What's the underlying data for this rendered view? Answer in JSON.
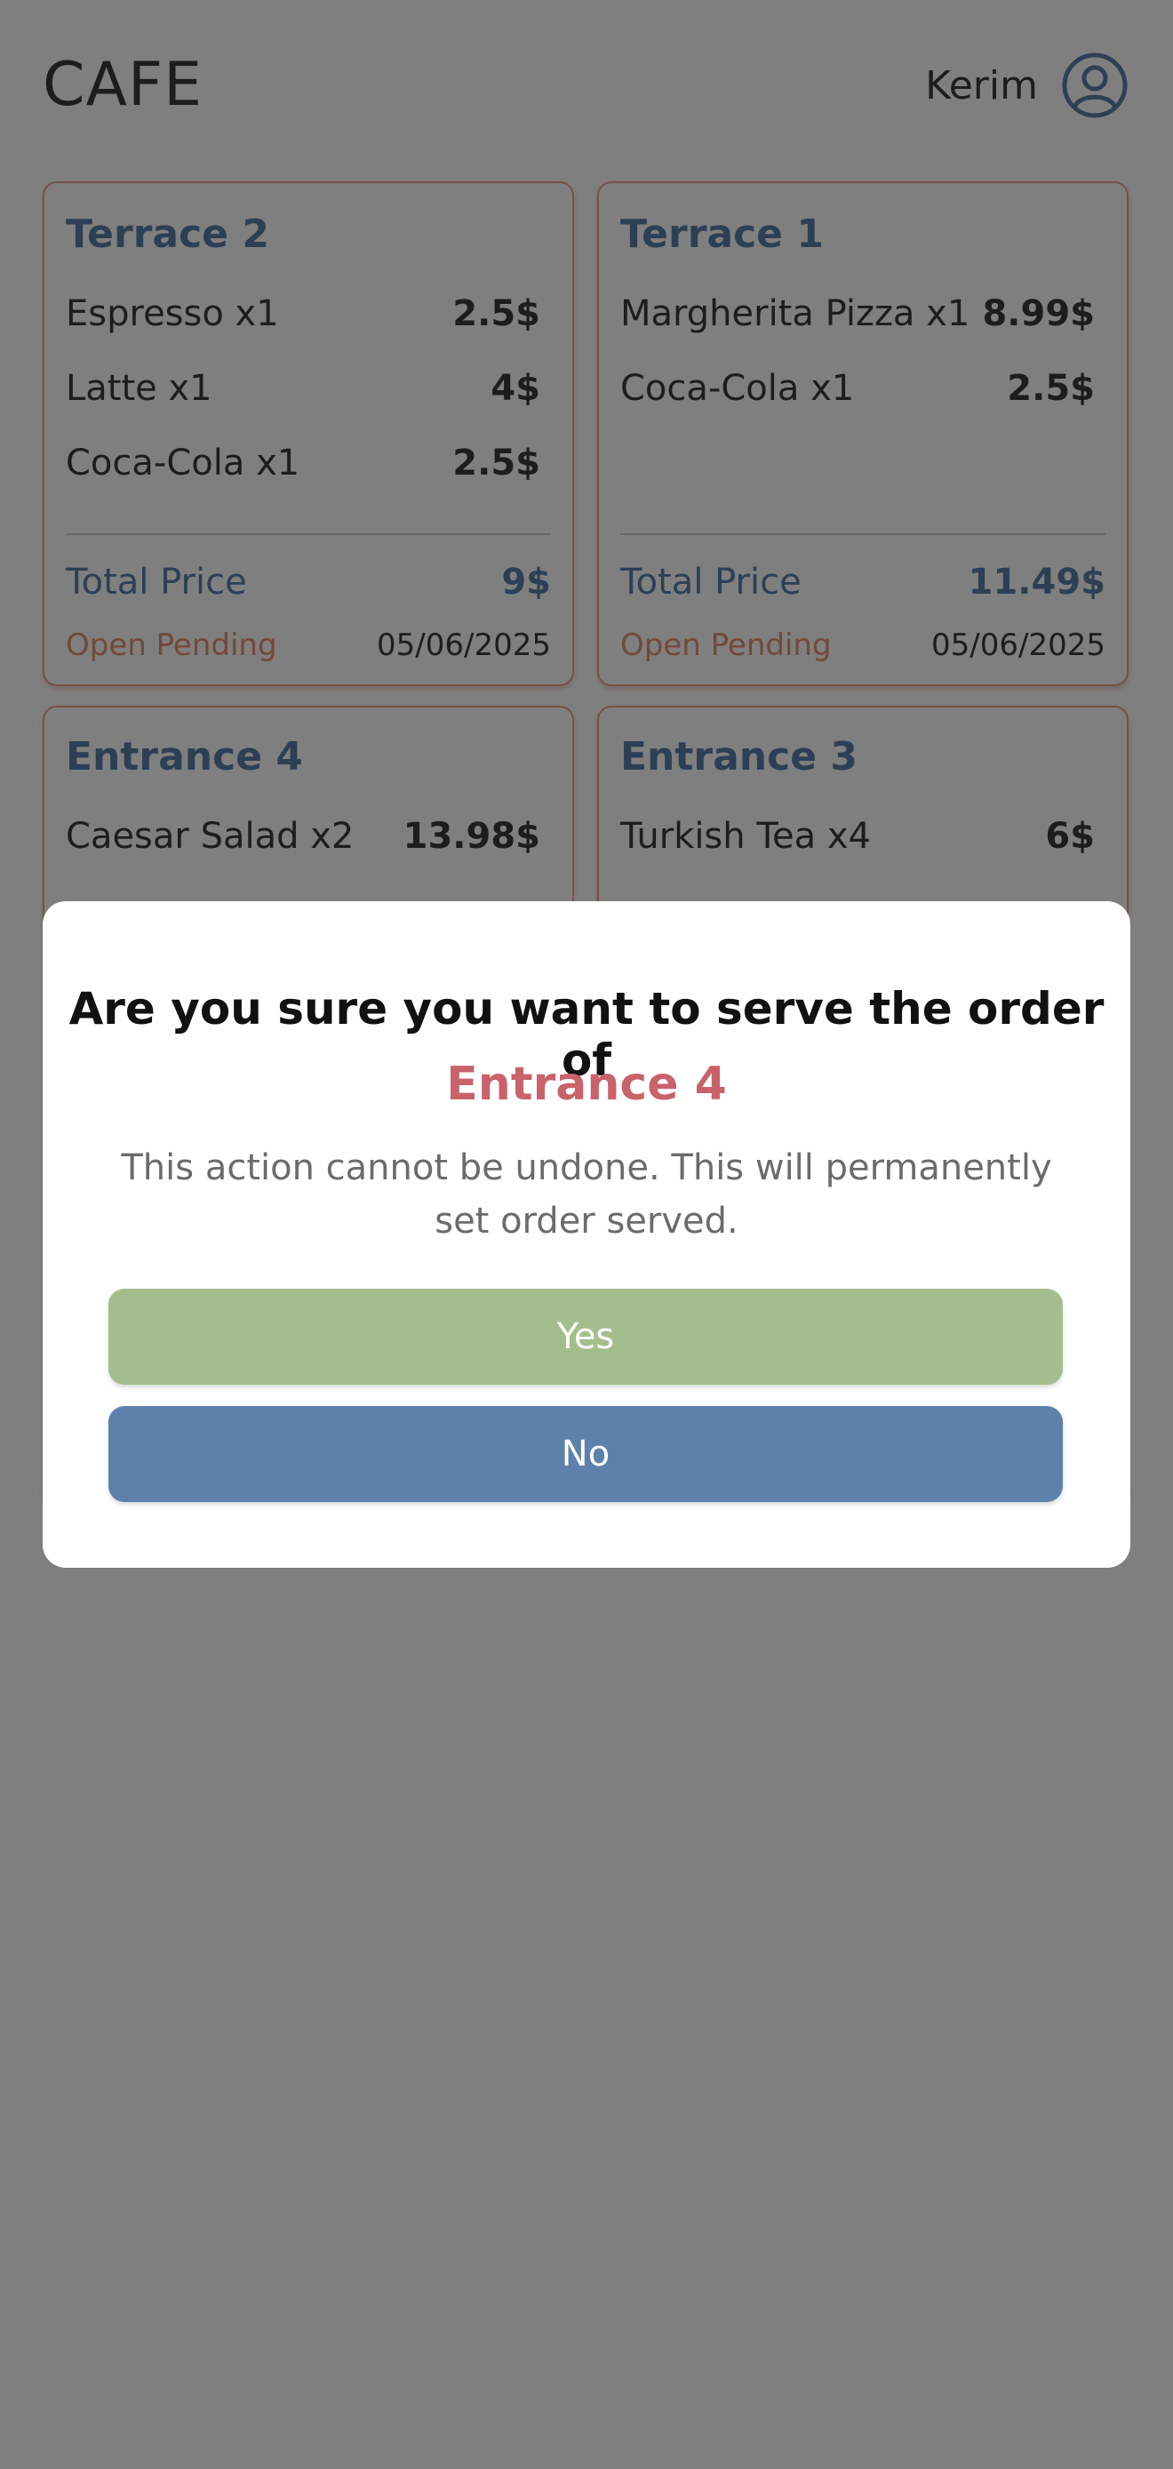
{
  "app": {
    "title": "CAFE",
    "user_name": "Kerim",
    "user_icon": "user-circle-icon"
  },
  "orders": [
    {
      "table": "Terrace 2",
      "items": [
        {
          "name": "Espresso x1",
          "price": "2.5$"
        },
        {
          "name": "Latte x1",
          "price": "4$"
        },
        {
          "name": "Coca-Cola x1",
          "price": "2.5$"
        }
      ],
      "total_label": "Total Price",
      "total": "9$",
      "status": "Open Pending",
      "date": "05/06/2025"
    },
    {
      "table": "Terrace 1",
      "items": [
        {
          "name": "Margherita Pizza x1",
          "price": "8.99$"
        },
        {
          "name": "Coca-Cola x1",
          "price": "2.5$"
        }
      ],
      "total_label": "Total Price",
      "total": "11.49$",
      "status": "Open Pending",
      "date": "05/06/2025"
    },
    {
      "table": "Entrance 4",
      "items": [
        {
          "name": "Caesar Salad x2",
          "price": "13.98$"
        }
      ]
    },
    {
      "table": "Entrance 3",
      "items": [
        {
          "name": "Turkish Tea x4",
          "price": "6$"
        }
      ]
    }
  ],
  "dialog": {
    "question": "Are you sure you want to serve the order of",
    "target": "Entrance 4",
    "description": "This action cannot be undone. This will permanently set order served.",
    "yes_label": "Yes",
    "no_label": "No"
  },
  "colors": {
    "accent_blue": "#5e81ac",
    "card_title": "#5b7fab",
    "status_orange": "#e89073",
    "card_border": "#e8a48f",
    "target_red": "#c9626b",
    "yes_green": "#a3be8c"
  }
}
